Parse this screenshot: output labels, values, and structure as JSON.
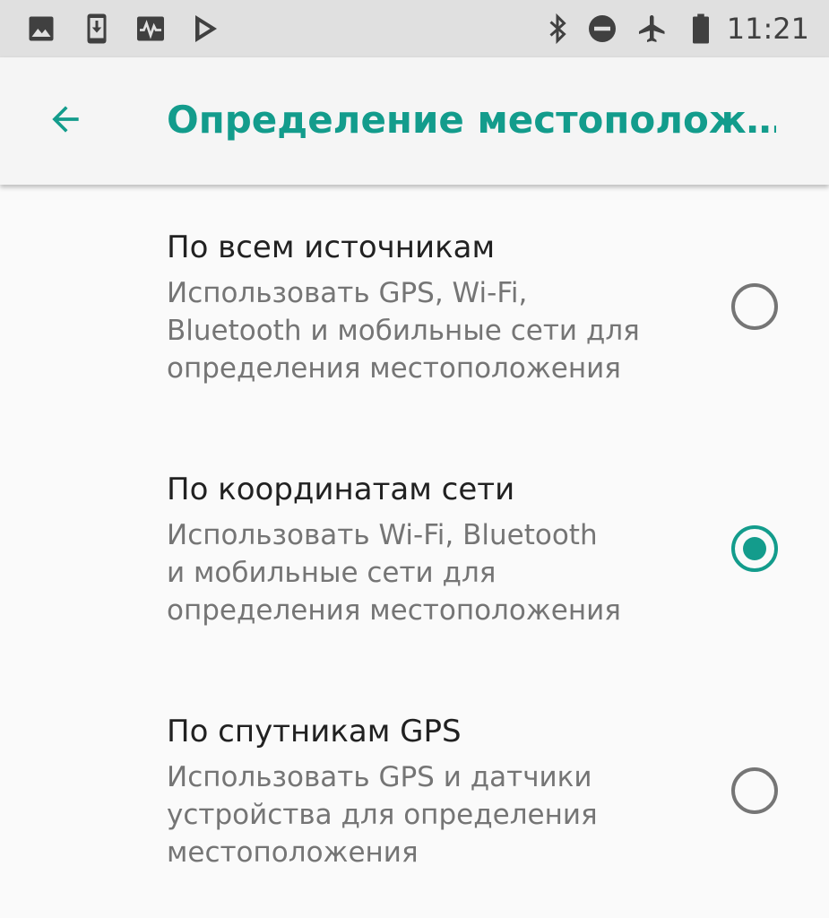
{
  "status_bar": {
    "time": "11:21",
    "left_icons": [
      "image-icon",
      "download-icon",
      "activity-icon",
      "play-store-icon"
    ],
    "right_icons": [
      "bluetooth-icon",
      "do-not-disturb-icon",
      "airplane-mode-icon",
      "battery-icon"
    ]
  },
  "app_bar": {
    "back_icon": "arrow-back-icon",
    "title": "Определение местополож…",
    "accent_color": "#139c8c"
  },
  "options": [
    {
      "title": "По всем источникам",
      "description": [
        "Использовать GPS, Wi-Fi,",
        "Bluetooth и мобильные сети для",
        "определения местоположения"
      ],
      "selected": false
    },
    {
      "title": "По координатам сети",
      "description": [
        "Использовать Wi-Fi, Bluetooth",
        "и мобильные сети для",
        "определения местоположения"
      ],
      "selected": true
    },
    {
      "title": "По спутникам GPS",
      "description": [
        "Использовать GPS и датчики",
        "устройства для определения",
        "местоположения"
      ],
      "selected": false
    }
  ]
}
